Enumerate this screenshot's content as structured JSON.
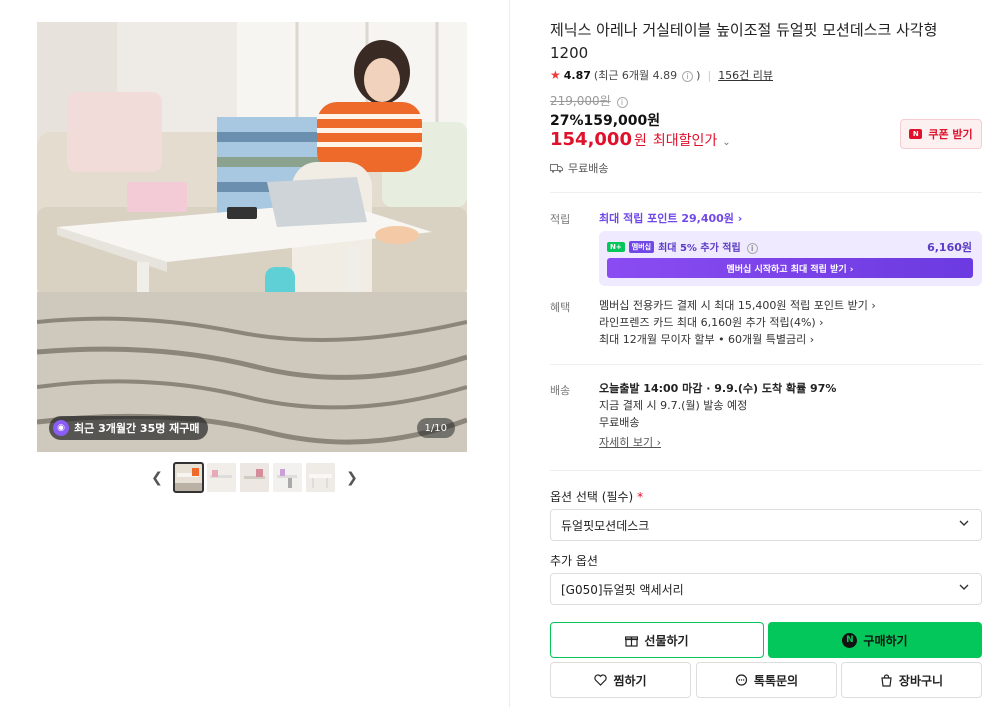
{
  "gallery": {
    "repurchase_badge": "최근 3개월간 35명 재구매",
    "counter": "1/10",
    "thumb_count": 5,
    "active_thumb": 0
  },
  "product": {
    "title": "제닉스 아레나 거실테이블 높이조절 듀얼핏 모션데스크 사각형 1200",
    "rating": "4.87",
    "rating_recent": "(최근 6개월 4.89",
    "rating_recent_close": ")",
    "review_count": "156건 리뷰",
    "original_price": "219,000",
    "original_unit": "원",
    "discount": "27%159,000원",
    "final_price": "154,000",
    "final_unit": "원",
    "final_label": "최대할인가",
    "coupon_label": "쿠폰 받기",
    "shipping": "무료배송"
  },
  "points": {
    "label": "적립",
    "max_points": "최대 적립 포인트 29,400원 ›",
    "member_badge_n": "N+",
    "member_badge": "멤버십",
    "member_text": "최대 5% 추가 적립",
    "member_amount": "6,160원",
    "member_cta": "멤버십 시작하고 최대 적립 받기 ›"
  },
  "benefits": {
    "label": "혜택",
    "lines": [
      "멤버십 전용카드 결제 시 최대 15,400원 적립 포인트 받기 ›",
      "라인프렌즈 카드 최대 6,160원 추가 적립(4%) ›",
      "최대 12개월 무이자 할부 • 60개월 특별금리 ›"
    ]
  },
  "delivery": {
    "label": "배송",
    "line1": "오늘출발 14:00 마감 · 9.9.(수) 도착 확률 97%",
    "line2": "지금 결제 시 9.7.(월) 발송 예정",
    "line3": "무료배송",
    "detail_link": "자세히 보기 ›"
  },
  "options": {
    "required_label": "옵션 선택 (필수)",
    "required_mark": "*",
    "required_value": "듀얼핏모션데스크",
    "extra_label": "추가 옵션",
    "extra_value": "[G050]듀얼핏 액세서리"
  },
  "actions": {
    "gift": "선물하기",
    "buy": "구매하기",
    "wish": "찜하기",
    "talk": "톡톡문의",
    "cart": "장바구니"
  },
  "colors": {
    "naver_green": "#03c75a",
    "price_red": "#e0112b",
    "membership_purple": "#7048e8"
  }
}
